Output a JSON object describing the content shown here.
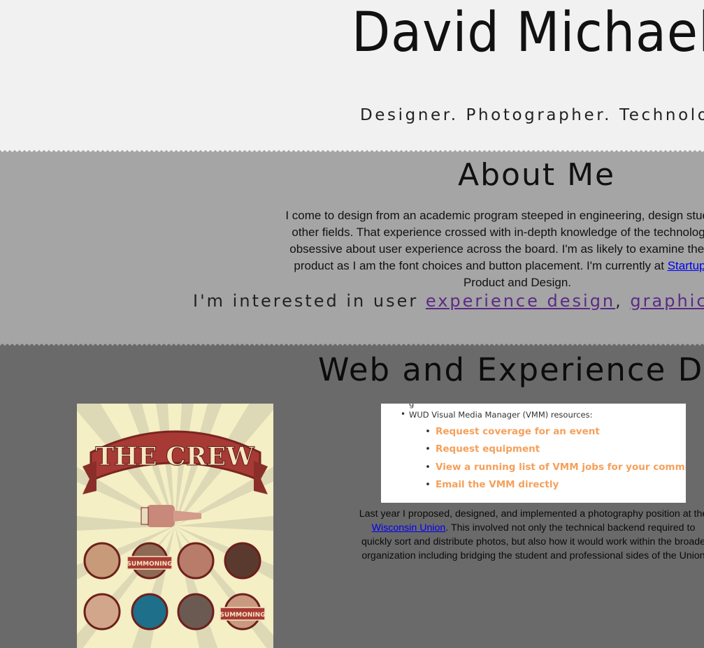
{
  "hero": {
    "name": "David Michaels",
    "tagline": "Designer. Photographer. Technologist."
  },
  "about": {
    "title": "About Me",
    "bio_lines": [
      "I come to design from an academic program steeped in engineering, design studies, psy",
      "other fields. That experience crossed with in-depth knowledge of the technology indus",
      "obsessive about user experience across the board. I'm as likely to examine the frame r",
      "product as I am the font choices and button placement. I'm currently at "
    ],
    "bio_link": "Startup Institu",
    "bio_last_line": "Product and Design.",
    "interests_prefix": "I'm interested in user ",
    "interest_link_1": "experience design",
    "interest_sep": ", ",
    "interest_link_2": "graphic design"
  },
  "work": {
    "title": "Web and Experience Des",
    "poster": {
      "heading": "THE CREW",
      "badge": "SUMMONING",
      "colors": {
        "banner": "#a73a35",
        "bg": "#f4efc4",
        "ray": "#d8d3b0"
      }
    },
    "panel": {
      "cut_text": "g",
      "parent_item": "WUD Visual Media Manager (VMM) resources:",
      "links": [
        "Request coverage for an event",
        "Request equipment",
        "View a running list of VMM jobs for your committee",
        "Email the VMM directly"
      ]
    },
    "desc_line1": "Last year I proposed, designed, and implemented a photography position at the",
    "desc_link": "Wisconsin Union",
    "desc_line2_rest": ". This involved not only the technical backend required to",
    "desc_line3": "quickly sort and distribute photos, but also how it would work within the broade",
    "desc_line4": "organization including bridging the student and professional sides of the Union"
  }
}
